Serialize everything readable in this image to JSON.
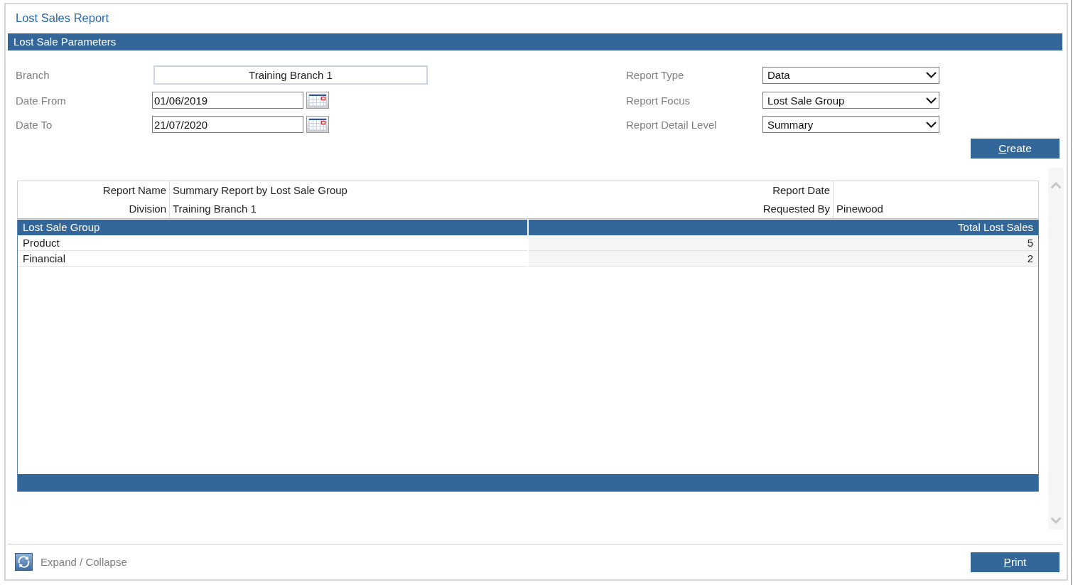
{
  "window": {
    "title": "Lost Sales Report"
  },
  "parameters": {
    "title": "Lost Sale Parameters",
    "left_fields": [
      {
        "kind": "readonly",
        "label": "Branch",
        "value": "Training Branch 1"
      },
      {
        "kind": "date",
        "label": "Date From",
        "value": "01/06/2019"
      },
      {
        "kind": "date",
        "label": "Date To",
        "value": "21/07/2020"
      }
    ],
    "right_fields": [
      {
        "kind": "select",
        "label": "Report Type",
        "value": "Data"
      },
      {
        "kind": "select",
        "label": "Report Focus",
        "value": "Lost Sale Group"
      },
      {
        "kind": "select",
        "label": "Report Detail Level",
        "value": "Summary"
      }
    ],
    "create_button": "Create"
  },
  "report": {
    "info_rows": [
      {
        "label": "Report Name",
        "value": "Summary Report by Lost Sale Group",
        "right_label": "Report Date"
      },
      {
        "label": "Division",
        "value": "Training Branch 1",
        "right_label": "Requested By",
        "right_value": "Pinewood"
      }
    ],
    "table": {
      "columns": [
        "Lost Sale Group",
        "Total Lost Sales"
      ],
      "rows": [
        [
          "Product",
          "5"
        ],
        [
          "Financial",
          "2"
        ]
      ]
    }
  },
  "footer": {
    "toggle_label": "Expand / Collapse",
    "print_button": "Print"
  }
}
